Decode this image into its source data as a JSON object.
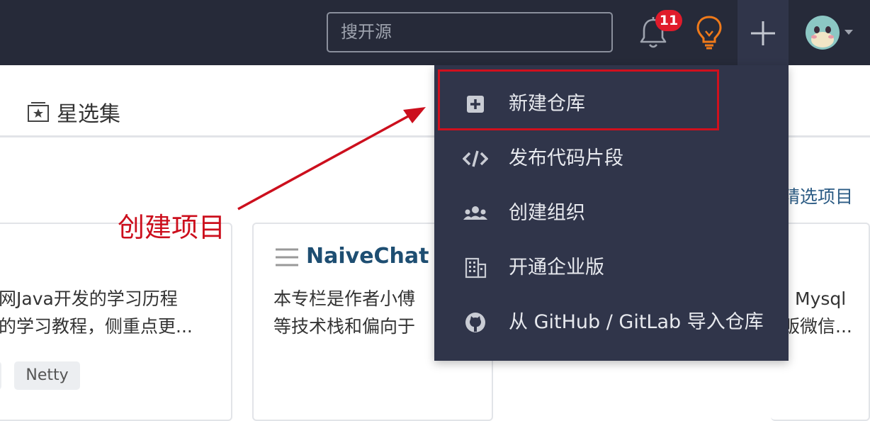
{
  "header": {
    "search_placeholder": "搜开源",
    "notification_count": "11"
  },
  "tabs": {
    "collections_label": "星选集"
  },
  "main": {
    "featured_link": "精选项目",
    "cards": [
      {
        "line1": "网Java开发的学习历程",
        "line2": "的学习教程，侧重点更...",
        "tag": "Netty"
      },
      {
        "title": "NaiveChat",
        "line1": "本专栏是作者小傅",
        "line2": "等技术栈和偏向于"
      },
      {
        "line1": "Mysql",
        "line2": "贩微信..."
      }
    ]
  },
  "dropdown": {
    "items": [
      {
        "label": "新建仓库",
        "icon": "plus-square-icon"
      },
      {
        "label": "发布代码片段",
        "icon": "code-icon"
      },
      {
        "label": "创建组织",
        "icon": "users-icon"
      },
      {
        "label": "开通企业版",
        "icon": "building-icon"
      },
      {
        "label": "从 GitHub / GitLab 导入仓库",
        "icon": "github-icon"
      }
    ]
  },
  "annotation": {
    "label": "创建项目"
  },
  "colors": {
    "topbar": "#262a39",
    "dropdown_bg": "#30354a",
    "highlight": "#d0101d",
    "badge": "#e01b2b",
    "bulb": "#f07a1a",
    "title_blue": "#1e4e72"
  }
}
